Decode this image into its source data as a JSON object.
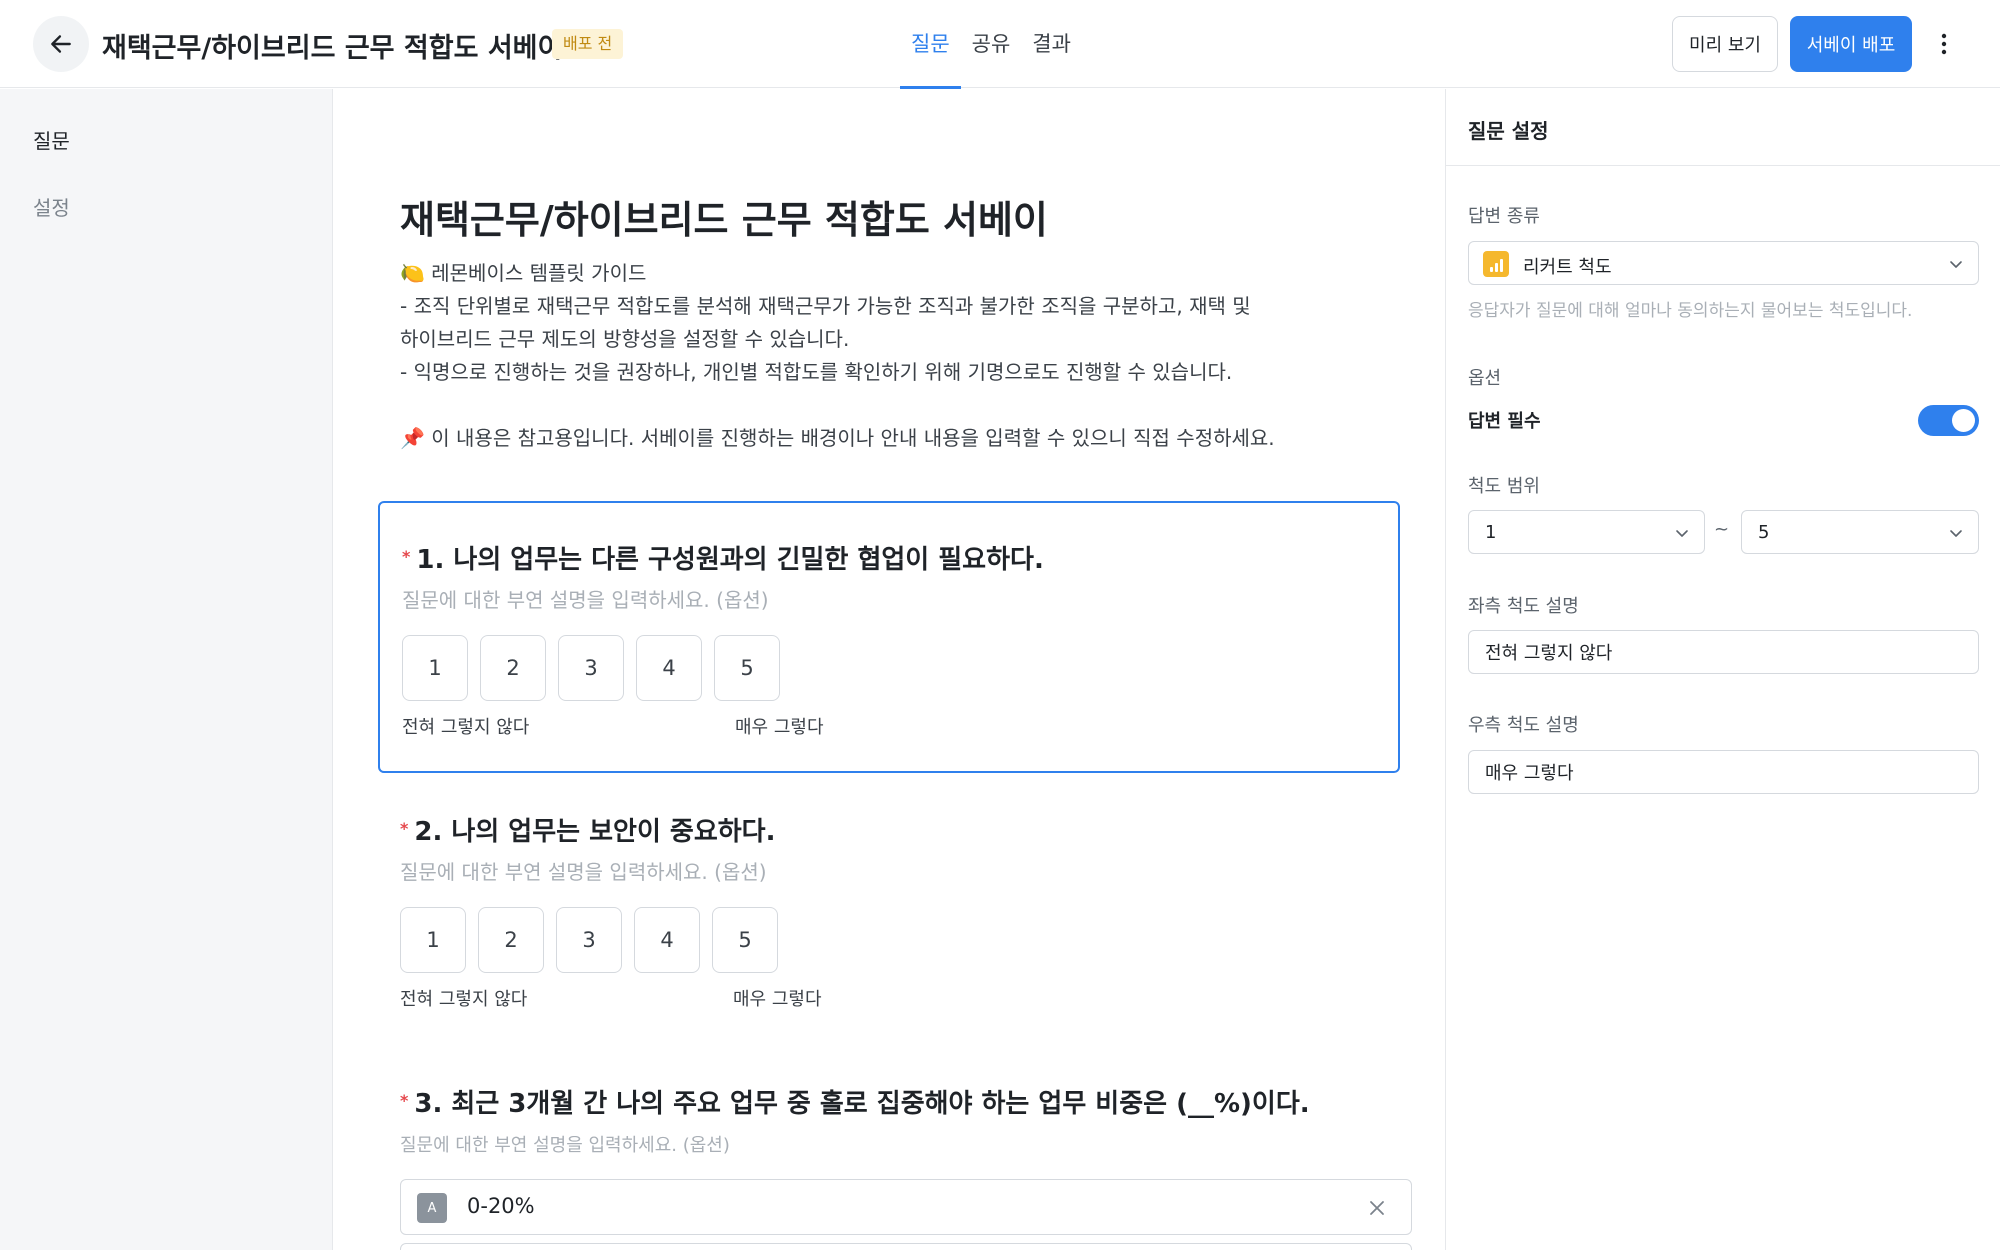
{
  "header": {
    "title": "재택근무/하이브리드 근무 적합도 서베이",
    "status_badge": "배포 전",
    "tabs": [
      {
        "label": "질문",
        "active": true
      },
      {
        "label": "공유",
        "active": false
      },
      {
        "label": "결과",
        "active": false
      }
    ],
    "preview_label": "미리 보기",
    "publish_label": "서베이 배포",
    "icons": {
      "back": "arrow-left-icon",
      "more": "more-vertical-icon"
    }
  },
  "sidebar": {
    "items": [
      {
        "label": "질문",
        "active": true
      },
      {
        "label": "설정",
        "active": false
      }
    ]
  },
  "survey": {
    "title": "재택근무/하이브리드 근무 적합도 서베이",
    "description": {
      "line1": "🍋 레몬베이스 템플릿 가이드",
      "line2": "- 조직 단위별로 재택근무 적합도를 분석해 재택근무가 가능한 조직과 불가한 조직을 구분하고, 재택 및",
      "line3": "하이브리드 근무 제도의 방향성을 설정할 수 있습니다.",
      "line4": "- 익명으로 진행하는 것을 권장하나, 개인별 적합도를 확인하기 위해 기명으로도 진행할 수 있습니다.",
      "line5": "📌 이 내용은 참고용입니다. 서베이를 진행하는 배경이나 안내 내용을 입력할 수 있으니 직접 수정하세요."
    },
    "questions": [
      {
        "required_mark": "*",
        "title": "1. 나의 업무는 다른 구성원과의 긴밀한 협업이 필요하다.",
        "description_placeholder": "질문에 대한 부연 설명을 입력하세요. (옵션)",
        "scale": [
          "1",
          "2",
          "3",
          "4",
          "5"
        ],
        "left_label": "전혀 그렇지 않다",
        "right_label": "매우 그렇다",
        "selected": true
      },
      {
        "required_mark": "*",
        "title": "2. 나의 업무는 보안이 중요하다.",
        "description_placeholder": "질문에 대한 부연 설명을 입력하세요. (옵션)",
        "scale": [
          "1",
          "2",
          "3",
          "4",
          "5"
        ],
        "left_label": "전혀 그렇지 않다",
        "right_label": "매우 그렇다",
        "selected": false
      },
      {
        "required_mark": "*",
        "title": "3. 최근 3개월 간 나의 주요 업무 중 홀로 집중해야 하는 업무 비중은 (__%)이다.",
        "description_placeholder": "질문에 대한 부연 설명을 입력하세요. (옵션)",
        "choices": [
          {
            "letter": "A",
            "text": "0-20%"
          }
        ]
      }
    ]
  },
  "settings_panel": {
    "title": "질문 설정",
    "answer_type": {
      "label": "답변 종류",
      "value": "리커트 척도",
      "hint": "응답자가 질문에 대해 얼마나 동의하는지 물어보는 척도입니다.",
      "icon": "bar-chart-icon",
      "icon_color": "#f5b82e"
    },
    "options": {
      "label": "옵션",
      "required_label": "답변 필수",
      "required_on": true
    },
    "scale_range": {
      "label": "척도 범위",
      "min": "1",
      "separator": "~",
      "max": "5"
    },
    "left_desc": {
      "label": "좌측 척도 설명",
      "value": "전혀 그렇지 않다"
    },
    "right_desc": {
      "label": "우측 척도 설명",
      "value": "매우 그렇다"
    }
  },
  "colors": {
    "accent": "#2f80ed",
    "required": "#e5484d",
    "badge_bg": "#fdf3d6",
    "badge_text": "#c08a12"
  }
}
